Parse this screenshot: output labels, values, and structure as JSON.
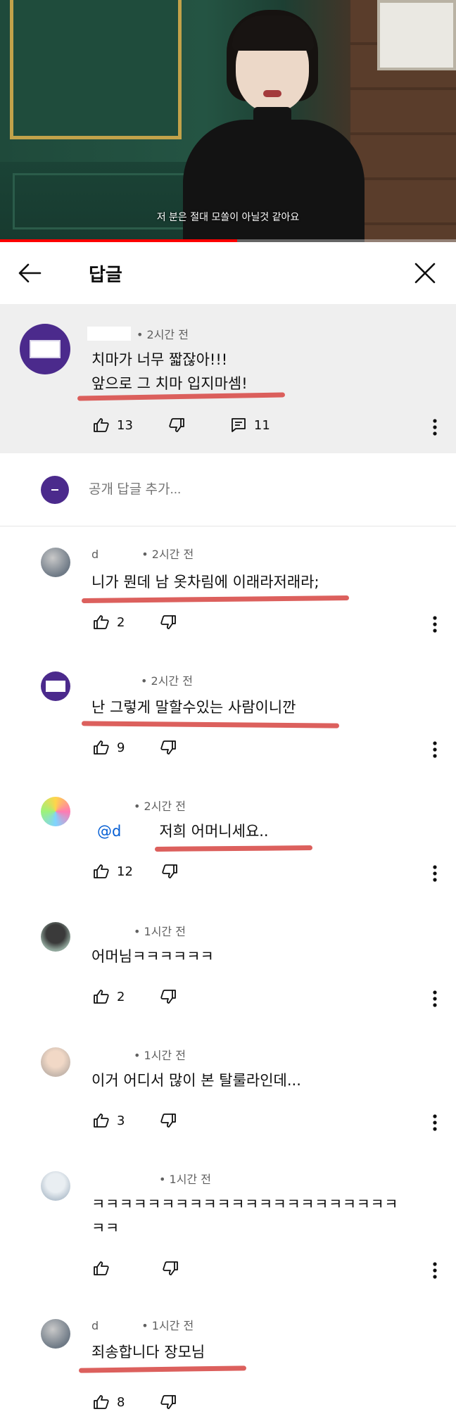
{
  "video": {
    "subtitle": "저 분은 절대 모쏠이 아닐것 같아요",
    "progress": 0.52
  },
  "header": {
    "title": "답글"
  },
  "parent_comment": {
    "time": "• 2시간 전",
    "text_line1": "치마가 너무 짧잖아!!!",
    "text_line2": "앞으로 그 치마 입지마셈!",
    "likes": "13",
    "replies": "11"
  },
  "add_reply": {
    "placeholder": "공개 답글 추가..."
  },
  "replies": [
    {
      "author": "d",
      "time": "• 2시간 전",
      "text": "니가 뭔데 남 옷차림에 이래라저래라;",
      "likes": "2"
    },
    {
      "author": "",
      "time": "• 2시간 전",
      "text": "난 그렇게 말할수있는 사람이니깐",
      "likes": "9"
    },
    {
      "author": "",
      "time": "• 2시간 전",
      "mention": "@d",
      "text": "저희 어머니세요..",
      "likes": "12"
    },
    {
      "author": "",
      "time": "• 1시간 전",
      "text": "어머님ㅋㅋㅋㅋㅋㅋ",
      "likes": "2"
    },
    {
      "author": "",
      "time": "• 1시간 전",
      "text": "이거 어디서 많이 본 탈룰라인데...",
      "likes": "3"
    },
    {
      "author": "",
      "time": "• 1시간 전",
      "text_line1": "ㅋㅋㅋㅋㅋㅋㅋㅋㅋㅋㅋㅋㅋㅋㅋㅋㅋㅋㅋㅋㅋㅋ",
      "text_line2": "ㅋㅋ",
      "likes": ""
    },
    {
      "author": "d",
      "time": "• 1시간 전",
      "text": "죄송합니다 장모님",
      "likes": "8"
    }
  ],
  "colors": {
    "underline": "#d9534f",
    "purple_avatar": "#4b2a8c",
    "mention": "#065fd4"
  }
}
